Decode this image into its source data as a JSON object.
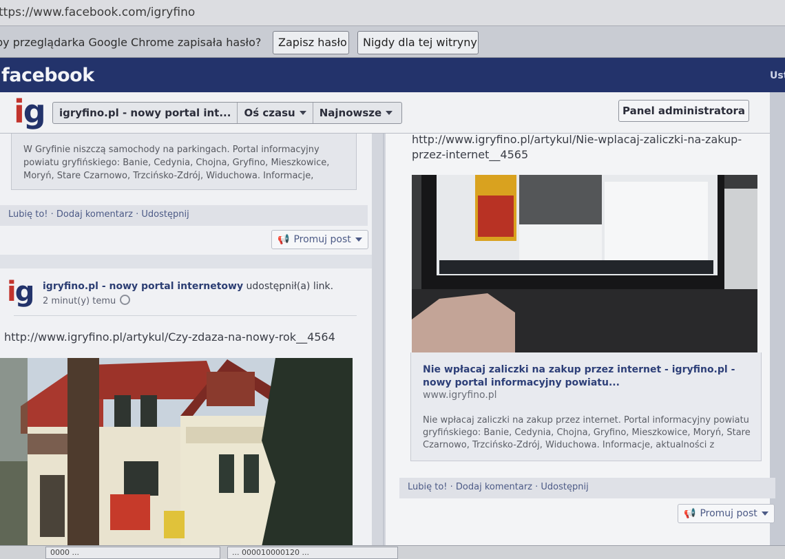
{
  "browser": {
    "url": "ttps://www.facebook.com/igryfino",
    "password_prompt": "py przeglądarka Google Chrome zapisała hasło?",
    "save_password_button": "Zapisz hasło",
    "never_button": "Nigdy dla tej witryny"
  },
  "facebook_bar": {
    "logo": "facebook",
    "right_text": "Ust"
  },
  "page_header": {
    "logo_i": "i",
    "logo_g": "g",
    "nav": [
      "igryfino.pl - nowy portal int...",
      "Oś czasu",
      "Najnowsze"
    ],
    "admin_button": "Panel administratora"
  },
  "left_post_1": {
    "preview_text": "W Gryfinie niszczą samochody na parkingach. Portal informacyjny powiatu gryfińskiego: Banie, Cedynia, Chojna, Gryfino, Mieszkowice, Moryń, Stare Czarnowo, Trzcińsko-Zdrój, Widuchowa. Informacje,",
    "actions": "Lubię to! · Dodaj komentarz · Udostępnij",
    "promote": "Promuj post"
  },
  "left_post_2": {
    "author": "igryfino.pl - nowy portal internetowy",
    "action": "udostępnił(a) link.",
    "time": "2 minut(y) temu",
    "link": "http://www.igryfino.pl/artykul/Czy-zdaza-na-nowy-rok__4564"
  },
  "right_post": {
    "link": "http://www.igryfino.pl/artykul/Nie-wplacaj-zaliczki-na-zakup-przez-internet__4565",
    "card_title": "Nie wpłacaj zaliczki na zakup przez internet - igryfino.pl - nowy portal informacyjny powiatu...",
    "card_domain": "www.igryfino.pl",
    "card_desc": "Nie wpłacaj zaliczki na zakup przez internet. Portal informacyjny powiatu gryfińskiego: Banie, Cedynia, Chojna, Gryfino, Mieszkowice, Moryń, Stare Czarnowo, Trzcińsko-Zdrój, Widuchowa. Informacje, aktualności z",
    "actions": "Lubię to! · Dodaj komentarz · Udostępnij",
    "promote": "Promuj post"
  },
  "bottom_tabs": [
    "0000 ...",
    "... 000010000120 ..."
  ]
}
